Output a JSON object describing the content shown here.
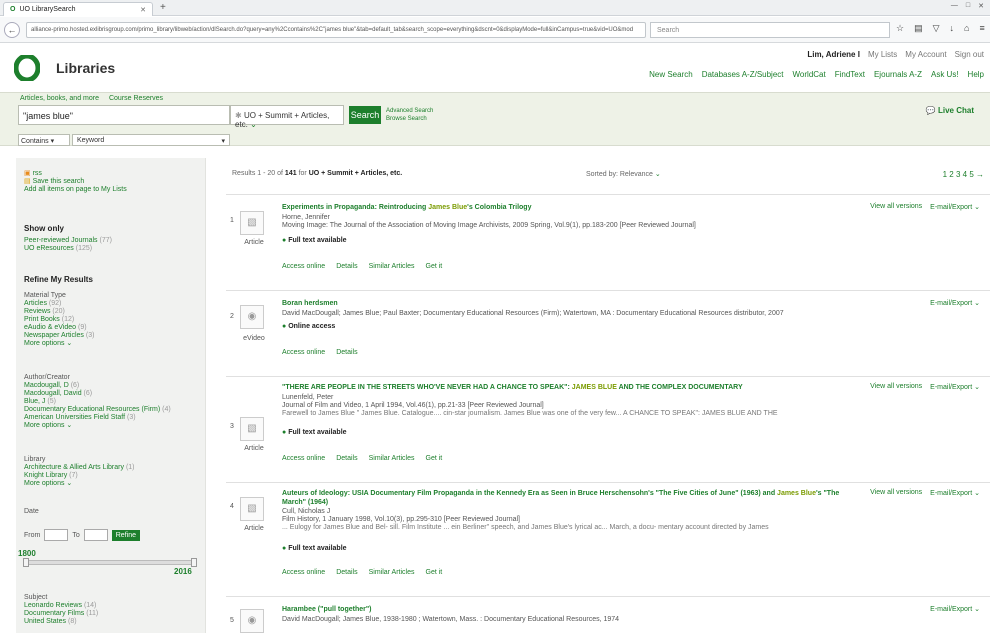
{
  "browser": {
    "tab_title": "UO LibrarySearch",
    "url": "alliance-primo.hosted.exlibrisgroup.com/primo_library/libweb/action/dlSearch.do?query=any%2Ccontains%2C\"james blue\"&tab=default_tab&search_scope=everything&dscnt=0&displayMode=full&inCampus=true&vid=UO&mod",
    "search_placeholder": "Search"
  },
  "user_nav": {
    "user": "Lim, Adriene I",
    "items": [
      "My Lists",
      "My Account",
      "Sign out"
    ]
  },
  "header": {
    "title": "Libraries",
    "nav": [
      "New Search",
      "Databases A-Z/Subject",
      "WorldCat",
      "FindText",
      "Ejournals A-Z",
      "Ask Us!",
      "Help"
    ]
  },
  "search": {
    "tabs": [
      "Articles, books, and more",
      "Course Reserves"
    ],
    "query": "\"james blue\"",
    "scope": "UO + Summit + Articles, etc.",
    "button": "Search",
    "advanced": "Advanced Search",
    "browse": "Browse Search",
    "live_chat": "Live Chat",
    "contains": "Contains",
    "keyword": "Keyword"
  },
  "sidebar": {
    "tools": [
      "rss",
      "Save this search",
      "Add all items on page to My Lists"
    ],
    "show_only": {
      "heading": "Show only",
      "items": [
        {
          "label": "Peer-reviewed Journals",
          "count": "(77)"
        },
        {
          "label": "UO eResources",
          "count": "(125)"
        }
      ]
    },
    "refine_heading": "Refine My Results",
    "material_type": {
      "heading": "Material Type",
      "items": [
        {
          "label": "Articles",
          "count": "(92)"
        },
        {
          "label": "Reviews",
          "count": "(20)"
        },
        {
          "label": "Print Books",
          "count": "(12)"
        },
        {
          "label": "eAudio & eVideo",
          "count": "(9)"
        },
        {
          "label": "Newspaper Articles",
          "count": "(3)"
        }
      ],
      "more": "More options"
    },
    "author": {
      "heading": "Author/Creator",
      "items": [
        {
          "label": "Macdougall, D",
          "count": "(6)"
        },
        {
          "label": "Macdougall, David",
          "count": "(6)"
        },
        {
          "label": "Blue, J",
          "count": "(5)"
        },
        {
          "label": "Documentary Educational Resources (Firm)",
          "count": "(4)"
        },
        {
          "label": "American Universities Field Staff",
          "count": "(3)"
        }
      ],
      "more": "More options"
    },
    "library": {
      "heading": "Library",
      "items": [
        {
          "label": "Architecture & Allied Arts Library",
          "count": "(1)"
        },
        {
          "label": "Knight Library",
          "count": "(7)"
        }
      ],
      "more": "More options"
    },
    "date": {
      "heading": "Date",
      "from": "From",
      "to": "To",
      "refine": "Refine",
      "min": "1800",
      "max": "2016"
    },
    "subject": {
      "heading": "Subject",
      "items": [
        {
          "label": "Leonardo Reviews",
          "count": "(14)"
        },
        {
          "label": "Documentary Films",
          "count": "(11)"
        },
        {
          "label": "United States",
          "count": "(8)"
        }
      ]
    }
  },
  "results": {
    "info_prefix": "Results 1 - 20 of",
    "total": "141",
    "for_label": "for",
    "scope": "UO + Summit + Articles, etc.",
    "sort": "Sorted by: Relevance",
    "pages": "1 2 3 4 5",
    "items": [
      {
        "num": "1",
        "type": "Article",
        "title_a": "Experiments in Propaganda: Reintroducing ",
        "title_hl": "James Blue",
        "title_b": "'s Colombia Trilogy",
        "line1": "Horne, Jennifer",
        "line2": "Moving Image: The Journal of the Association of Moving Image Archivists, 2009 Spring, Vol.9(1), pp.183-200 [Peer Reviewed Journal]",
        "line3": "",
        "avail": "Full text available",
        "actions": [
          "Access online",
          "Details",
          "Similar Articles",
          "Get it"
        ],
        "right": [
          "View all versions",
          "E-mail/Export"
        ]
      },
      {
        "num": "2",
        "type": "eVideo",
        "title_a": "Boran herdsmen",
        "title_hl": "",
        "title_b": "",
        "line1": "David MacDougall; James Blue; Paul Baxter; Documentary Educational Resources (Firm); Watertown, MA : Documentary Educational Resources distributor, 2007",
        "line2": "",
        "line3": "",
        "avail": "Online access",
        "actions": [
          "Access online",
          "Details"
        ],
        "right": [
          "E-mail/Export"
        ]
      },
      {
        "num": "3",
        "type": "Article",
        "title_a": "\"THERE ARE PEOPLE IN THE STREETS WHO'VE NEVER HAD A CHANCE TO SPEAK\": ",
        "title_hl": "JAMES BLUE",
        "title_b": " AND THE COMPLEX DOCUMENTARY",
        "line1": "Lunenfeld, Peter",
        "line2": "Journal of Film and Video, 1 April 1994, Vol.46(1), pp.21-33 [Peer Reviewed Journal]",
        "line3": "Farewell to James Blue \" James Blue. Catalogue.... cin-star journalism. James Blue was one of the very few... A CHANCE TO SPEAK\": JAMES BLUE AND THE",
        "avail": "Full text available",
        "actions": [
          "Access online",
          "Details",
          "Similar Articles",
          "Get it"
        ],
        "right": [
          "View all versions",
          "E-mail/Export"
        ]
      },
      {
        "num": "4",
        "type": "Article",
        "title_a": "Auteurs of Ideology: USIA Documentary Film Propaganda in the Kennedy Era as Seen in Bruce Herschensohn's \"The Five Cities of June\" (1963) and ",
        "title_hl": "James Blue",
        "title_b": "'s \"The March\" (1964)",
        "line1": "Cull, Nicholas J",
        "line2": "Film History, 1 January 1998, Vol.10(3), pp.295-310 [Peer Reviewed Journal]",
        "line3": "... Eulogy for James Blue and Bel- sill. Film Institute ... ein Berliner\" speech, and James Blue's lyrical ac... March, a docu- mentary account directed by James",
        "avail": "Full text available",
        "actions": [
          "Access online",
          "Details",
          "Similar Articles",
          "Get it"
        ],
        "right": [
          "View all versions",
          "E-mail/Export"
        ]
      },
      {
        "num": "5",
        "type": "",
        "title_a": "Harambee (\"pull together\")",
        "title_hl": "",
        "title_b": "",
        "line1": "David MacDougall; James Blue, 1938-1980 ; Watertown, Mass. : Documentary Educational Resources, 1974",
        "line2": "",
        "line3": "",
        "avail": "",
        "actions": [],
        "right": [
          "E-mail/Export"
        ]
      }
    ]
  }
}
